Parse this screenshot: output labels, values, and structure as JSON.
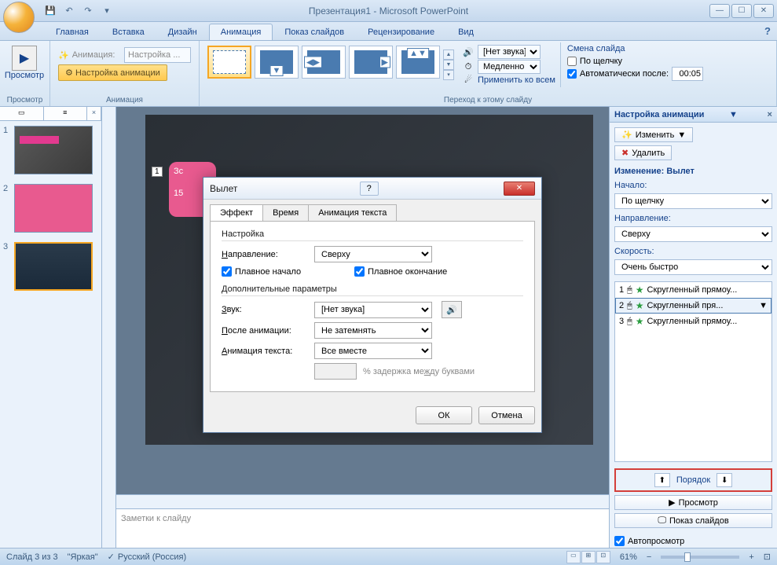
{
  "title": "Презентация1 - Microsoft PowerPoint",
  "tabs": {
    "home": "Главная",
    "insert": "Вставка",
    "design": "Дизайн",
    "animations": "Анимация",
    "slideshow": "Показ слайдов",
    "review": "Рецензирование",
    "view": "Вид"
  },
  "ribbon": {
    "preview": {
      "label": "Просмотр",
      "group": "Просмотр"
    },
    "animation": {
      "label": "Анимация:",
      "value": "Настройка ...",
      "config_btn": "Настройка анимации",
      "group": "Анимация"
    },
    "transition": {
      "sound_label": "[Нет звука]",
      "speed_label": "Медленно",
      "apply_all": "Применить ко всем",
      "group": "Переход к этому слайду"
    },
    "advance": {
      "group_title": "Смена слайда",
      "on_click": "По щелчку",
      "auto_after": "Автоматически после:",
      "time": "00:05"
    }
  },
  "thumbs": {
    "n1": "1",
    "n2": "2",
    "n3": "3"
  },
  "slide": {
    "tag": "1",
    "pink1": "Зс",
    "pink2": "15",
    "notes_placeholder": "Заметки к слайду"
  },
  "pane": {
    "title": "Настройка анимации",
    "change_btn": "Изменить",
    "remove_btn": "Удалить",
    "modify_label": "Изменение: Вылет",
    "start_label": "Начало:",
    "start_value": "По щелчку",
    "direction_label": "Направление:",
    "direction_value": "Сверху",
    "speed_label": "Скорость:",
    "speed_value": "Очень быстро",
    "items": {
      "i1": {
        "n": "1",
        "text": "Скругленный прямоу..."
      },
      "i2": {
        "n": "2",
        "text": "Скругленный пря..."
      },
      "i3": {
        "n": "3",
        "text": "Скругленный прямоу..."
      }
    },
    "order_label": "Порядок",
    "play_btn": "Просмотр",
    "slideshow_btn": "Показ слайдов",
    "autopreview": "Автопросмотр"
  },
  "dialog": {
    "title": "Вылет",
    "tabs": {
      "effect": "Эффект",
      "timing": "Время",
      "textanim": "Анимация текста"
    },
    "settings_label": "Настройка",
    "direction_label": "Направление:",
    "direction_value": "Сверху",
    "smooth_start": "Плавное начало",
    "smooth_end": "Плавное окончание",
    "enhance_label": "Дополнительные параметры",
    "sound_label": "Звук:",
    "sound_value": "[Нет звука]",
    "after_label": "После анимации:",
    "after_value": "Не затемнять",
    "textanim_label": "Анимация текста:",
    "textanim_value": "Все вместе",
    "delay_label": "% задержка между буквами",
    "ok": "ОК",
    "cancel": "Отмена"
  },
  "status": {
    "slide": "Слайд 3 из 3",
    "theme": "\"Яркая\"",
    "lang": "Русский (Россия)",
    "zoom": "61%"
  }
}
